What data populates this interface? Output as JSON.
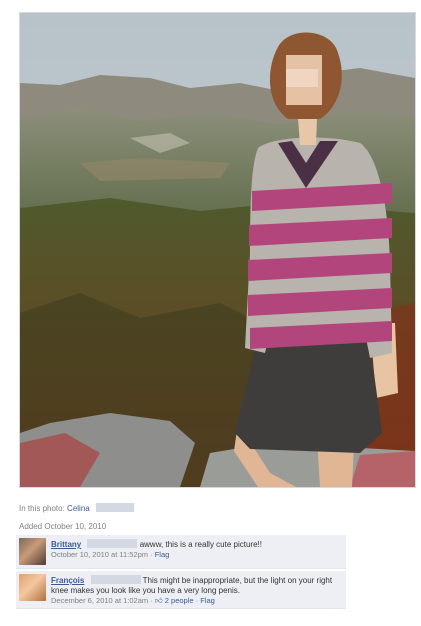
{
  "photo": {
    "alt": "photo"
  },
  "tagged": {
    "prefix": "In this photo:",
    "name": "Celina"
  },
  "added": {
    "text": "Added October 10, 2010"
  },
  "comments": [
    {
      "author": "Brittany",
      "text": "awww, this is a really cute picture!!",
      "time": "October 10, 2010 at 11:52pm",
      "sep": "·",
      "flag": "Flag"
    },
    {
      "author": "François",
      "text": "This might be inappropriate, but the light on your right knee makes you look like you have a very long penis.",
      "time": "December 6, 2010 at 1:02am",
      "sep": "·",
      "likes": "2 people",
      "flag": "Flag"
    }
  ],
  "colors": {
    "link": "#3b5998",
    "comment_bg": "#edeff4",
    "muted_text": "#808080"
  }
}
